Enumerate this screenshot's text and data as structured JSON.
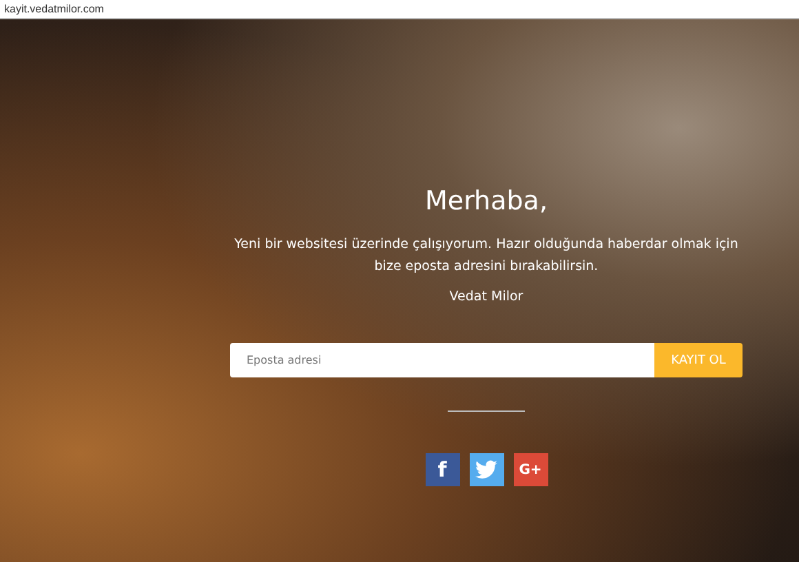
{
  "address_bar": {
    "url": "kayit.vedatmilor.com"
  },
  "hero": {
    "title": "Merhaba,",
    "message": "Yeni bir websitesi üzerinde çalışıyorum. Hazır olduğunda haberdar olmak için bize eposta adresini bırakabilirsin.",
    "signature": "Vedat Milor"
  },
  "signup": {
    "placeholder": "Eposta adresi",
    "button": "KAYIT OL"
  },
  "social": [
    {
      "kind": "facebook",
      "glyph": "f"
    },
    {
      "kind": "twitter"
    },
    {
      "kind": "googleplus",
      "glyph": "G+"
    }
  ]
}
